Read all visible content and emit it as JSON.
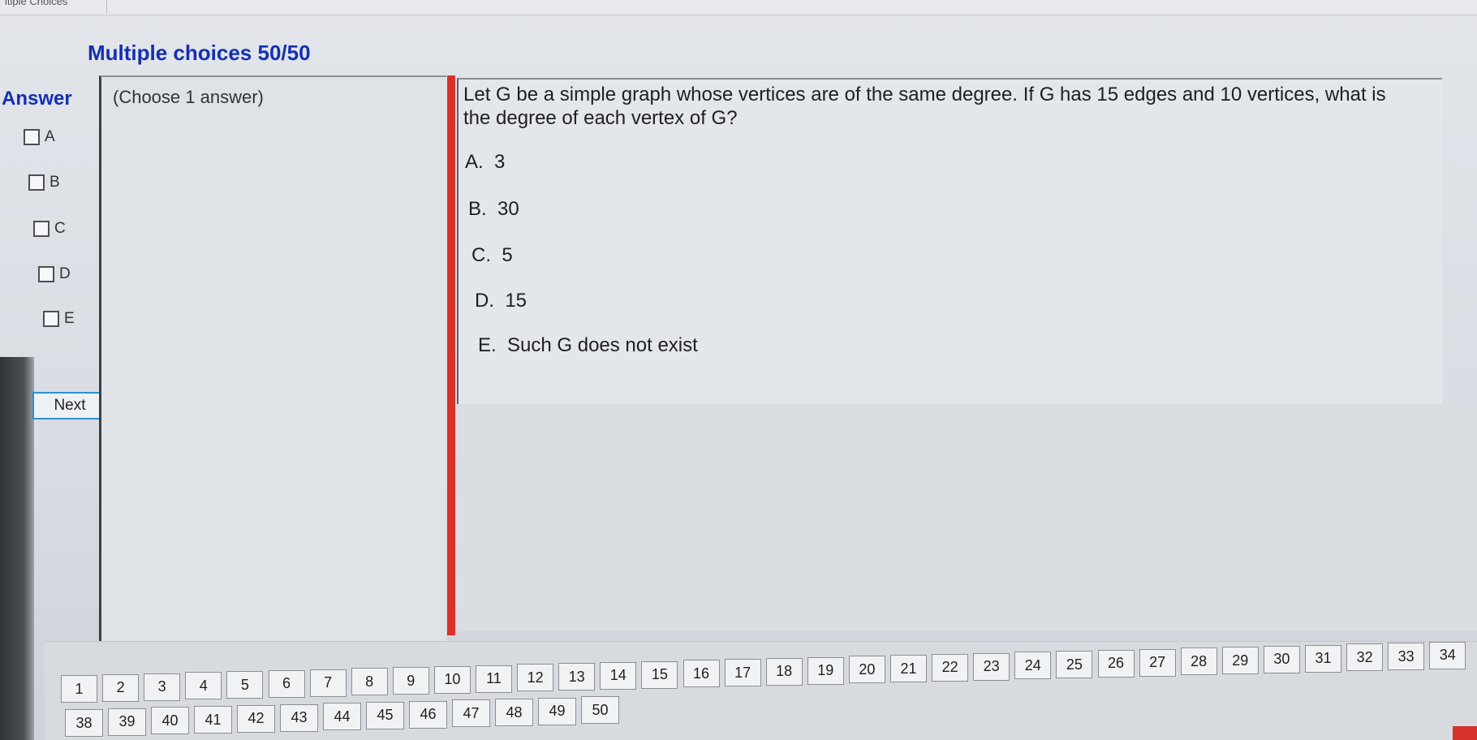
{
  "window": {
    "tab_fragment": "ltiple Choices"
  },
  "section": {
    "title": "Multiple choices 50/50"
  },
  "answer": {
    "label": "Answer",
    "choices": [
      "A",
      "B",
      "C",
      "D",
      "E"
    ]
  },
  "next_button": "Next",
  "choose_hint": "(Choose 1 answer)",
  "question": {
    "text": "Let G be a simple graph whose vertices are of the same degree.  If G has 15 edges and 10 vertices, what is the degree of each vertex of G?",
    "options": [
      "A.  3",
      "B.  30",
      "C.  5",
      "D.  15",
      "E.  Such G does not exist"
    ]
  },
  "question_numbers": {
    "row1": [
      "1",
      "2",
      "3",
      "4",
      "5",
      "6",
      "7",
      "8",
      "9",
      "10",
      "11",
      "12",
      "13",
      "14",
      "15",
      "16",
      "17",
      "18",
      "19",
      "20",
      "21",
      "22",
      "23",
      "24",
      "25",
      "26",
      "27",
      "28",
      "29",
      "30",
      "31",
      "32",
      "33",
      "34"
    ],
    "row2": [
      "38",
      "39",
      "40",
      "41",
      "42",
      "43",
      "44",
      "45",
      "46",
      "47",
      "48",
      "49",
      "50"
    ]
  },
  "colors": {
    "title_blue": "#1430b0",
    "divider_red": "#d9312b",
    "next_border": "#2f8fd0"
  }
}
